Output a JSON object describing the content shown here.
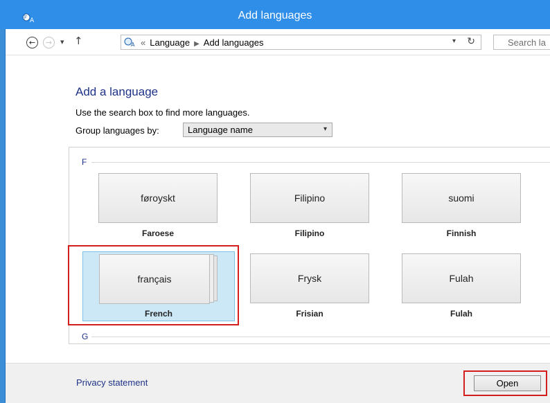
{
  "window": {
    "title": "Add languages"
  },
  "address_bar": {
    "breadcrumb_prefix": "«",
    "crumbs": [
      "Language",
      "Add languages"
    ],
    "search_placeholder": "Search la"
  },
  "main": {
    "heading": "Add a language",
    "hint": "Use the search box to find more languages.",
    "group_by_label": "Group languages by:",
    "group_by_value": "Language name"
  },
  "groups": [
    {
      "letter": "F",
      "languages": [
        {
          "native": "føroyskt",
          "english": "Faroese"
        },
        {
          "native": "Filipino",
          "english": "Filipino"
        },
        {
          "native": "suomi",
          "english": "Finnish"
        },
        {
          "native": "français",
          "english": "French",
          "selected": true
        },
        {
          "native": "Frysk",
          "english": "Frisian"
        },
        {
          "native": "Fulah",
          "english": "Fulah"
        }
      ]
    },
    {
      "letter": "G",
      "languages": []
    }
  ],
  "footer": {
    "privacy_link": "Privacy statement",
    "open_button": "Open"
  },
  "icons": {
    "app": "language-globe-icon",
    "back": "back-arrow-icon",
    "forward": "forward-arrow-icon",
    "up": "up-arrow-icon",
    "refresh": "refresh-icon",
    "search": "search-icon"
  },
  "colors": {
    "titlebar": "#2f8ee8",
    "heading": "#1e3287",
    "selection": "#cce8f7",
    "highlight": "#d41e1e"
  }
}
